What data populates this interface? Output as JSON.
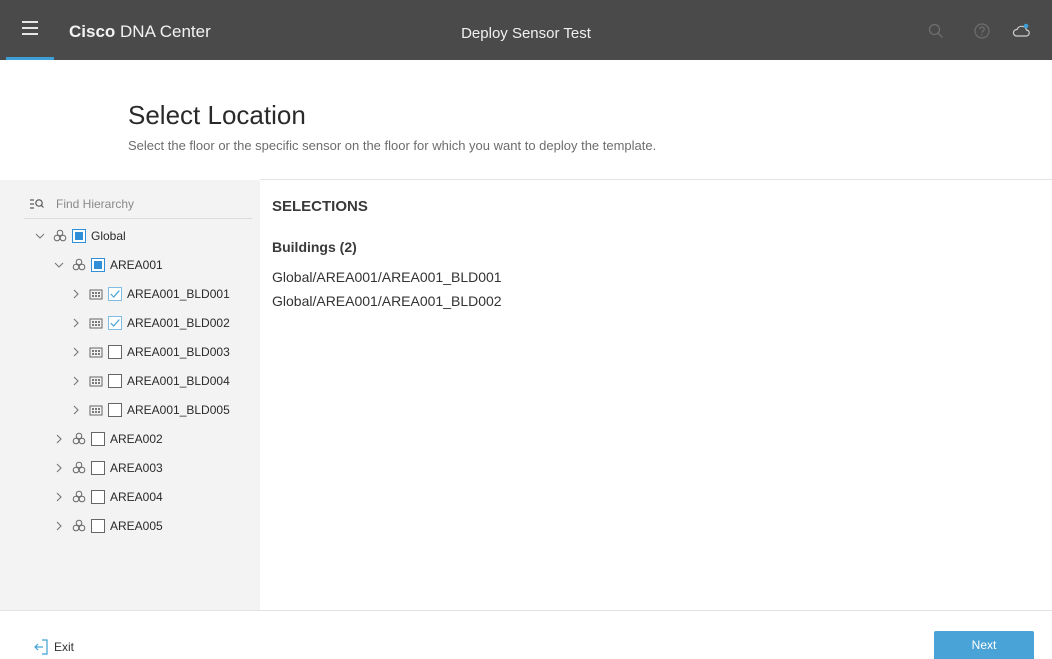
{
  "header": {
    "brand_bold": "Cisco",
    "brand_rest": "DNA Center",
    "title": "Deploy Sensor Test",
    "icons": [
      "menu-icon",
      "search-icon",
      "help-icon",
      "cloud-notification-icon"
    ],
    "accent_color": "#3e9fd6"
  },
  "page": {
    "title": "Select Location",
    "subtitle": "Select the floor or the specific sensor on the floor for which you want to deploy the template."
  },
  "search": {
    "placeholder": "Find Hierarchy"
  },
  "tree": {
    "items": [
      {
        "label": "Global",
        "level": 0,
        "expanded": true,
        "type": "area",
        "check": "partial"
      },
      {
        "label": "AREA001",
        "level": 1,
        "expanded": true,
        "type": "area",
        "check": "partial"
      },
      {
        "label": "AREA001_BLD001",
        "level": 2,
        "expanded": false,
        "type": "building",
        "check": "checked"
      },
      {
        "label": "AREA001_BLD002",
        "level": 2,
        "expanded": false,
        "type": "building",
        "check": "checked"
      },
      {
        "label": "AREA001_BLD003",
        "level": 2,
        "expanded": false,
        "type": "building",
        "check": "unchecked"
      },
      {
        "label": "AREA001_BLD004",
        "level": 2,
        "expanded": false,
        "type": "building",
        "check": "unchecked"
      },
      {
        "label": "AREA001_BLD005",
        "level": 2,
        "expanded": false,
        "type": "building",
        "check": "unchecked"
      },
      {
        "label": "AREA002",
        "level": 1,
        "expanded": false,
        "type": "area",
        "check": "unchecked"
      },
      {
        "label": "AREA003",
        "level": 1,
        "expanded": false,
        "type": "area",
        "check": "unchecked"
      },
      {
        "label": "AREA004",
        "level": 1,
        "expanded": false,
        "type": "area",
        "check": "unchecked"
      },
      {
        "label": "AREA005",
        "level": 1,
        "expanded": false,
        "type": "area",
        "check": "unchecked"
      }
    ]
  },
  "selections": {
    "title": "SELECTIONS",
    "group_title": "Buildings (2)",
    "items": [
      "Global/AREA001/AREA001_BLD001",
      "Global/AREA001/AREA001_BLD002"
    ]
  },
  "footer": {
    "exit_label": "Exit",
    "next_label": "Next",
    "next_color": "#4aa3d6"
  }
}
